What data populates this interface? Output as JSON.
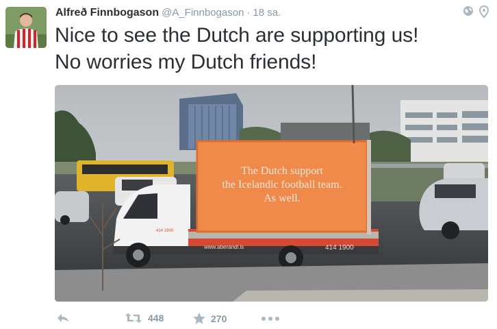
{
  "tweet": {
    "author_name": "Alfreð Finnbogason",
    "handle": "@A_Finnbogason",
    "separator": "·",
    "time": "18 sa.",
    "text_lines": [
      "Nice to see the Dutch are supporting us!",
      "No worries my Dutch friends!"
    ]
  },
  "media": {
    "sign_lines": [
      "The Dutch support",
      "the Icelandic football team.",
      "As well."
    ],
    "truck_url": "www.aberandi.is",
    "truck_phone": "414 1900",
    "truck_phone_small": "414 1900",
    "sign_color": "#f08a4b"
  },
  "actions": {
    "reply_icon": "reply-icon",
    "retweet_icon": "retweet-icon",
    "retweet_count": "448",
    "favorite_icon": "star-icon",
    "favorite_count": "270",
    "more_icon": "more-icon"
  },
  "top_icons": [
    "globe-icon",
    "location-pin-icon"
  ]
}
